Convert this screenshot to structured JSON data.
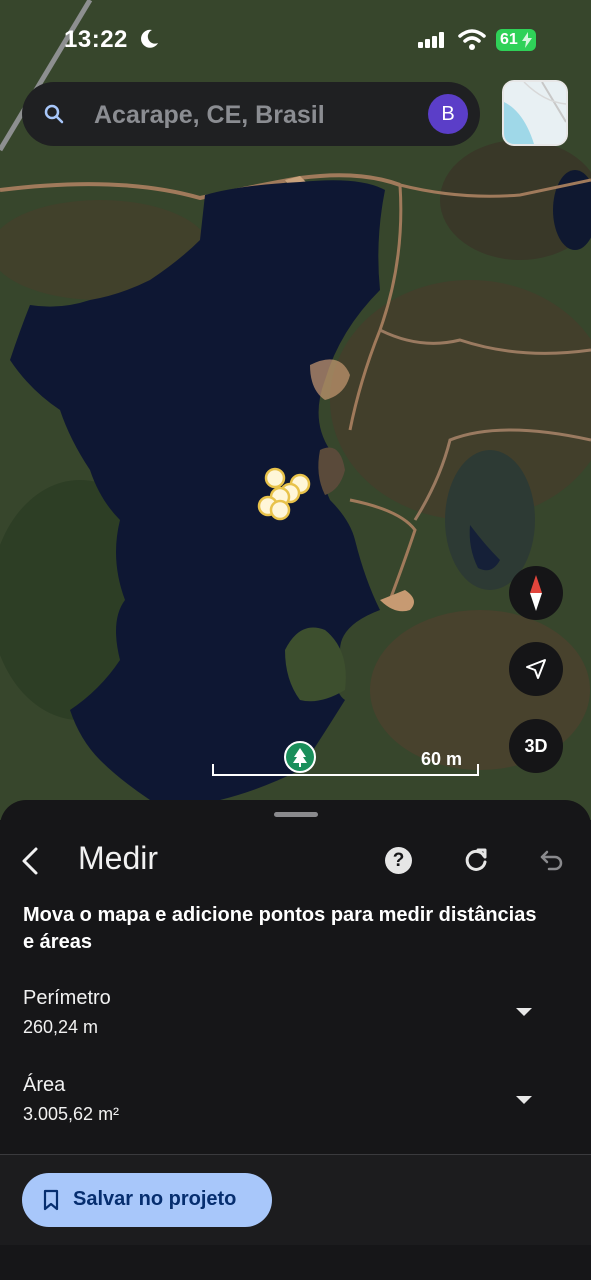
{
  "status_bar": {
    "time": "13:22",
    "battery": "61"
  },
  "search": {
    "text": "Acarape, CE, Brasil",
    "avatar_letter": "B"
  },
  "map": {
    "scale_label": "60 m",
    "compass": "compass-icon",
    "locate": "navigation-arrow-icon",
    "view_3d": "3D"
  },
  "sheet": {
    "title": "Medir",
    "instruction": "Mova o mapa e adicione pontos para medir distâncias e áreas",
    "perimeter": {
      "label": "Perímetro",
      "value": "260,24 m"
    },
    "area": {
      "label": "Área",
      "value": "3.005,62 m²"
    },
    "save_button": "Salvar no projeto"
  },
  "colors": {
    "accent_button": "#a8c7fa",
    "avatar": "#5b3ec8",
    "battery": "#2fd158",
    "sheet_bg": "#161618"
  }
}
